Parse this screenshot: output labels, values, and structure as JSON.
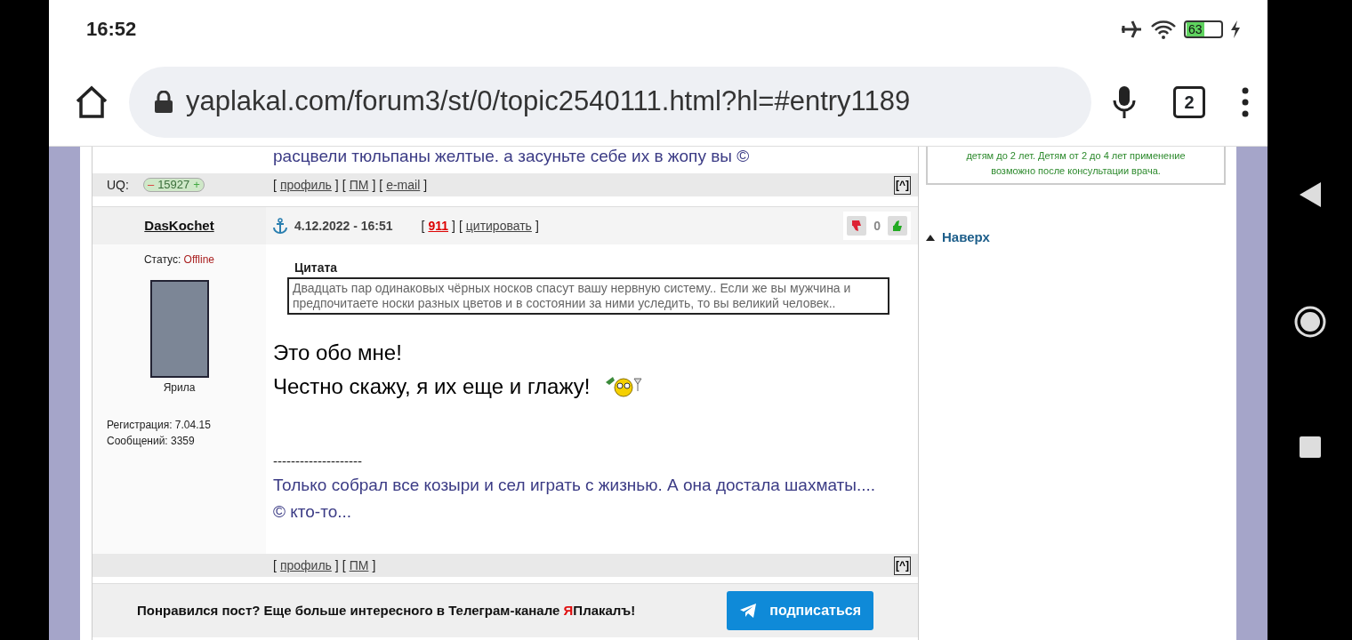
{
  "status_bar": {
    "time": "16:52",
    "battery": "63"
  },
  "browser": {
    "url": "yaplakal.com/forum3/st/0/topic2540111.html?hl=#entry1189",
    "tab_count": "2"
  },
  "previous_post": {
    "signature": "расцвели тюльпаны желтые. а засуньте себе их в жопу вы ©",
    "uq_label": "UQ:",
    "uq_minus": "–",
    "uq_value": "15927",
    "uq_plus": "+",
    "links": [
      {
        "before": "[",
        "label": "профиль",
        "after": "]"
      },
      {
        "before": "[",
        "label": "ПМ",
        "after": "]"
      },
      {
        "before": "[",
        "label": "e-mail",
        "after": "]"
      }
    ],
    "top_link": "[^]"
  },
  "post": {
    "author": "DasKochet",
    "date": "4.12.2022 - 16:51",
    "meta_links": [
      {
        "before": "[",
        "label": "911",
        "after": "]",
        "kind": "number"
      },
      {
        "before": "[",
        "label": "цитировать",
        "after": "]",
        "kind": "link"
      }
    ],
    "rating": "0",
    "status_label": "Статус:",
    "status": "Offline",
    "avatar_caption": "Ярила",
    "registration": "Регистрация: 7.04.15",
    "messages": "Сообщений: 3359",
    "quote_title": "Цитата",
    "quote_text": "Двадцать пар одинаковых чёрных носков спасут вашу нервную систему.. Если же вы мужчина и предпочитаете носки разных цветов и в состоянии за ними уследить, то вы великий человек..",
    "body": [
      "Это обо мне!",
      "Честно скажу, я их еще и глажу!"
    ],
    "separator": "--------------------",
    "signature": [
      "Только собрал все козыри и сел играть с жизнью. А она достала шахматы....",
      "© кто-то..."
    ],
    "links": [
      {
        "before": "[",
        "label": "профиль",
        "after": "]"
      },
      {
        "before": "[",
        "label": "ПМ",
        "after": "]"
      }
    ],
    "top_link": "[^]"
  },
  "banner": {
    "text_start": "Понравился пост? Еще больше интересного в Телеграм-канале ",
    "brand_accent": "Я",
    "brand_rest": "Плакалъ!",
    "button": "подписаться"
  },
  "sidebar": {
    "ad_lines": [
      "детям до 2 лет. Детям от 2 до 4 лет применение",
      "возможно после консультации врача."
    ],
    "top_link": "Наверх"
  }
}
